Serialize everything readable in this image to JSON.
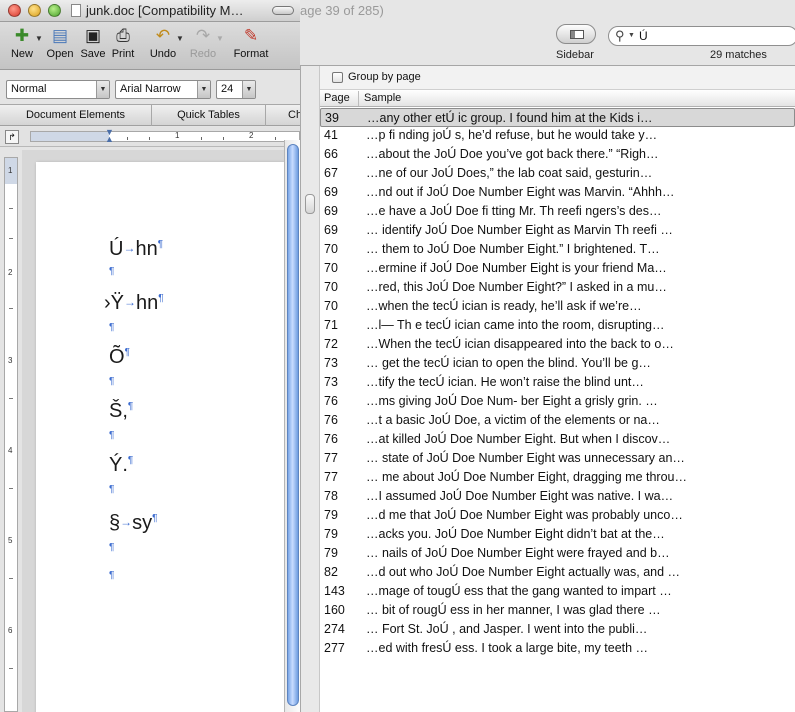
{
  "word": {
    "window_title": "junk.doc [Compatibility M…",
    "toolbar": {
      "new_label": "New",
      "open_label": "Open",
      "save_label": "Save",
      "print_label": "Print",
      "undo_label": "Undo",
      "redo_label": "Redo",
      "format_label": "Format"
    },
    "formatting": {
      "style_value": "Normal",
      "font_value": "Arial Narrow",
      "size_value": "24"
    },
    "ribbon_tabs": [
      "Document Elements",
      "Quick Tables",
      "Ch"
    ],
    "ruler_numbers": [
      "1",
      "2"
    ],
    "vruler_numbers": [
      "1",
      "2",
      "3",
      "4",
      "5",
      "6"
    ],
    "document_lines": [
      {
        "text": "Ú",
        "after_tab": "hn"
      },
      {
        "text": "›Ÿ",
        "after_tab": "hn"
      },
      {
        "text": "Õ",
        "after_tab": ""
      },
      {
        "text": "Š,",
        "after_tab": ""
      },
      {
        "text": "Ý.",
        "after_tab": ""
      },
      {
        "text": "§",
        "after_tab": "sy"
      }
    ],
    "pilcrow": "¶",
    "tab_mark": "→"
  },
  "preview": {
    "window_title_fragment": "age 39 of 285)",
    "sidebar_label": "Sidebar",
    "search_value": "Ú",
    "matches_label": "29 matches",
    "group_by_page_label": "Group by page",
    "group_by_page_checked": false,
    "columns": {
      "page": "Page",
      "sample": "Sample"
    },
    "selected_row_index": 0,
    "results": [
      {
        "page": "39",
        "sample": "…any other etÚ ic group.  I found him at the Kids i…"
      },
      {
        "page": "41",
        "sample": "…p fi nding joÚ s, he’d refuse, but he would  take y…"
      },
      {
        "page": "66",
        "sample": "…about the JoÚ  Doe  you’ve got back there.”  “Righ…"
      },
      {
        "page": "67",
        "sample": "…ne of our JoÚ  Does,” the  lab coat said, gesturin…"
      },
      {
        "page": "69",
        "sample": "…nd out if JoÚ  Doe Number Eight was Marvin.  “Ahhh…"
      },
      {
        "page": "69",
        "sample": "…e  have a JoÚ  Doe fi tting Mr. Th reefi ngers’s des…"
      },
      {
        "page": "69",
        "sample": "… identify JoÚ  Doe Number Eight as Marvin Th reefi …"
      },
      {
        "page": "70",
        "sample": "… them to  JoÚ  Doe Number Eight.”  I brightened. T…"
      },
      {
        "page": "70",
        "sample": "…ermine if JoÚ  Doe Number Eight is  your friend Ma…"
      },
      {
        "page": "70",
        "sample": "…red, this JoÚ  Doe Number Eight?” I asked in a  mu…"
      },
      {
        "page": "70",
        "sample": "…when the tecÚ ician is ready, he’ll ask if   we’re…"
      },
      {
        "page": "71",
        "sample": "…l—  Th e tecÚ ician came into the room, disrupting…"
      },
      {
        "page": "72",
        "sample": "…When the tecÚ ician disappeared into the back to o…"
      },
      {
        "page": "73",
        "sample": "… get the tecÚ ician to open the blind. You’ll be g…"
      },
      {
        "page": "73",
        "sample": "…tify the tecÚ ician. He won’t raise the blind  unt…"
      },
      {
        "page": "76",
        "sample": "…ms giving JoÚ  Doe Num-  ber Eight a grisly grin. …"
      },
      {
        "page": "76",
        "sample": "…t a basic JoÚ  Doe, a victim of the elements or na…"
      },
      {
        "page": "76",
        "sample": "…at killed JoÚ  Doe Number Eight. But when I discov…"
      },
      {
        "page": "77",
        "sample": "… state of JoÚ  Doe Number Eight was unnecessary an…"
      },
      {
        "page": "77",
        "sample": "… me about JoÚ  Doe Number Eight, dragging me throu…"
      },
      {
        "page": "78",
        "sample": "…I assumed JoÚ  Doe  Number Eight was native. I  wa…"
      },
      {
        "page": "79",
        "sample": "…d me that JoÚ  Doe Number Eight was  probably unco…"
      },
      {
        "page": "79",
        "sample": "…acks you. JoÚ   Doe Number Eight didn’t bat at the…"
      },
      {
        "page": "79",
        "sample": "… nails of JoÚ  Doe Number Eight  were frayed and b…"
      },
      {
        "page": "82",
        "sample": "…d out who JoÚ  Doe Number Eight actually was, and …"
      },
      {
        "page": "143",
        "sample": "…mage of tougÚ ess that the gang wanted  to impart …"
      },
      {
        "page": "160",
        "sample": "… bit of rougÚ ess in her manner, I was glad there …"
      },
      {
        "page": "274",
        "sample": "… Fort St. JoÚ , and  Jasper. I went into the publi…"
      },
      {
        "page": "277",
        "sample": "…ed with fresÚ ess.  I took a large bite, my teeth …"
      }
    ]
  },
  "colors": {
    "selected_row": "#d8d8d8",
    "scroll_thumb": "#7aa6e6",
    "nonprinting_marks": "#3c6cd0"
  }
}
